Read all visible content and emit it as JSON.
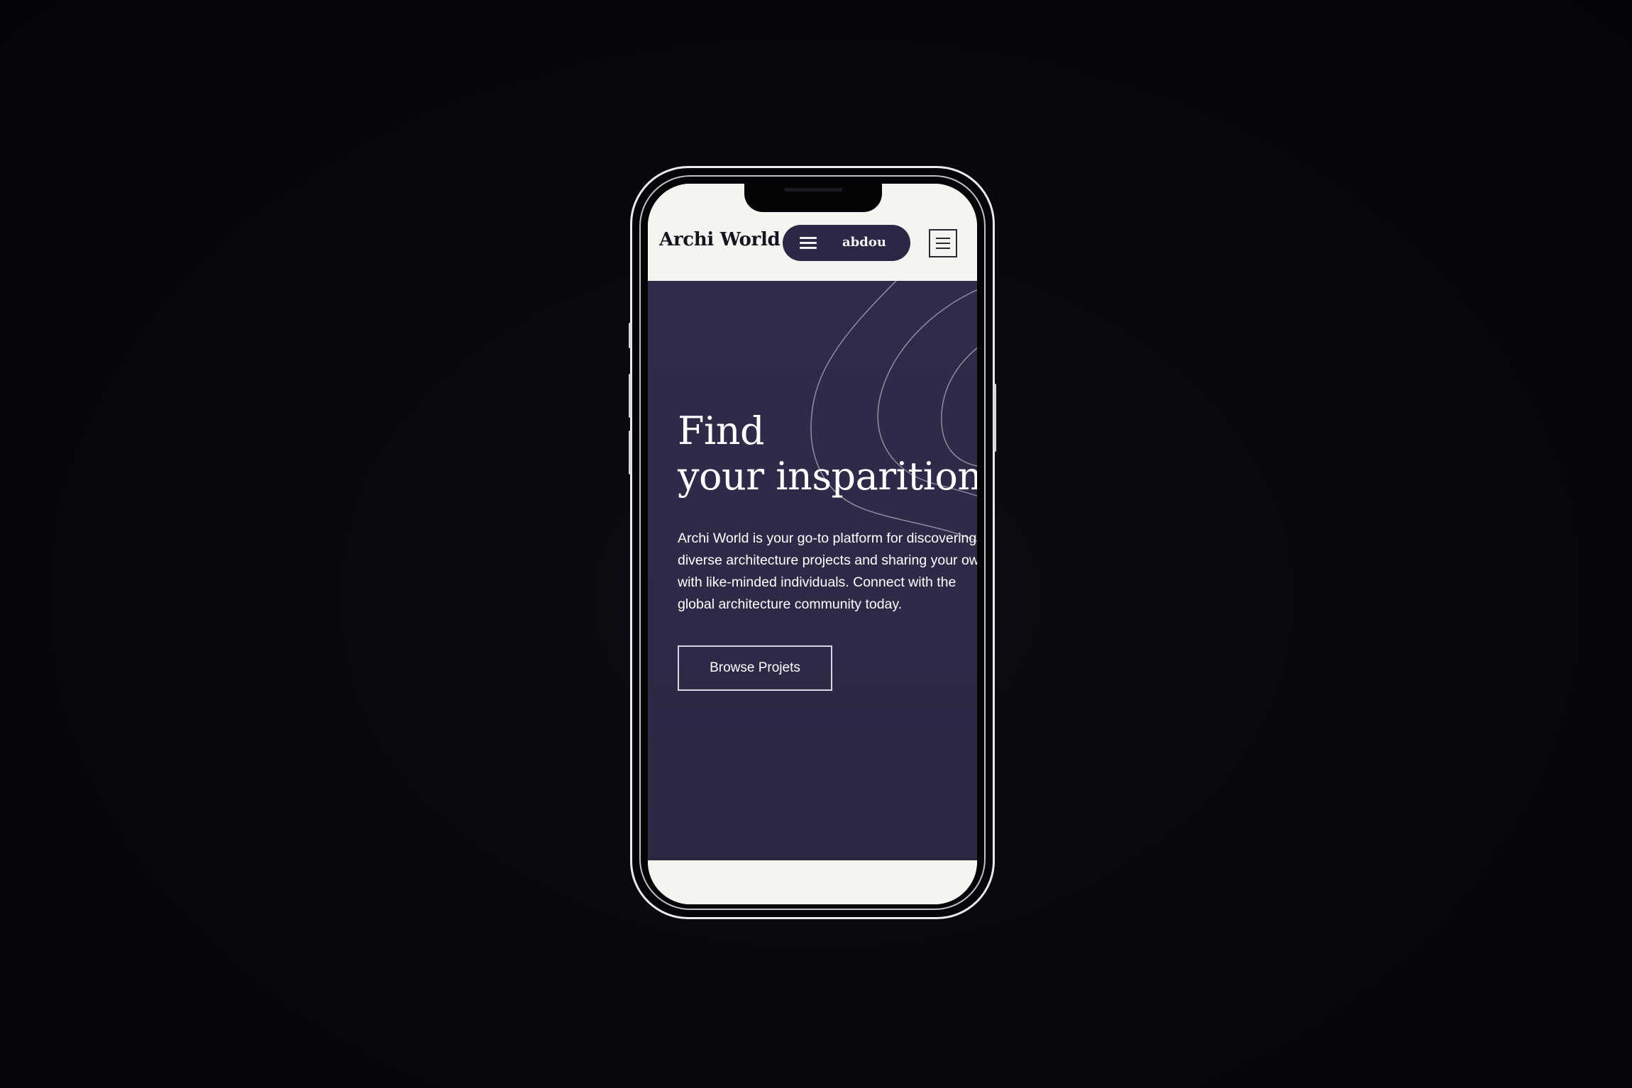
{
  "header": {
    "brand": "Archi World",
    "user_name": "abdou"
  },
  "hero": {
    "title_line1": "Find",
    "title_line2": "your insparition",
    "description": "Archi World is your go-to platform for discovering diverse architecture projects and sharing your own with like-minded individuals. Connect with the global architecture community today.",
    "button_label": "Browse Projets"
  },
  "icons": {
    "pill_menu": "hamburger-icon",
    "nav_menu": "hamburger-icon"
  },
  "colors": {
    "page_background": "#06070b",
    "hero_background": "#302b4a",
    "pill_background": "#2c2745",
    "header_background": "#f5f4f1",
    "text_light": "#ffffff",
    "text_dark": "#16151f"
  }
}
